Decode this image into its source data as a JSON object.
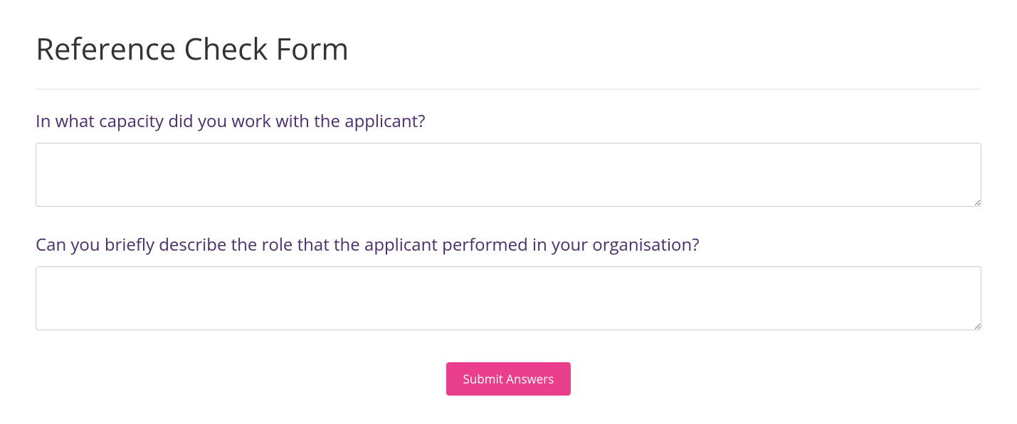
{
  "page": {
    "title": "Reference Check Form"
  },
  "questions": [
    {
      "label": "In what capacity did you work with the applicant?",
      "value": ""
    },
    {
      "label": "Can you briefly describe the role that the applicant performed in your organisation?",
      "value": ""
    }
  ],
  "actions": {
    "submit_label": "Submit Answers"
  },
  "colors": {
    "question_label": "#4b2e6b",
    "submit_bg": "#e83e8c"
  }
}
